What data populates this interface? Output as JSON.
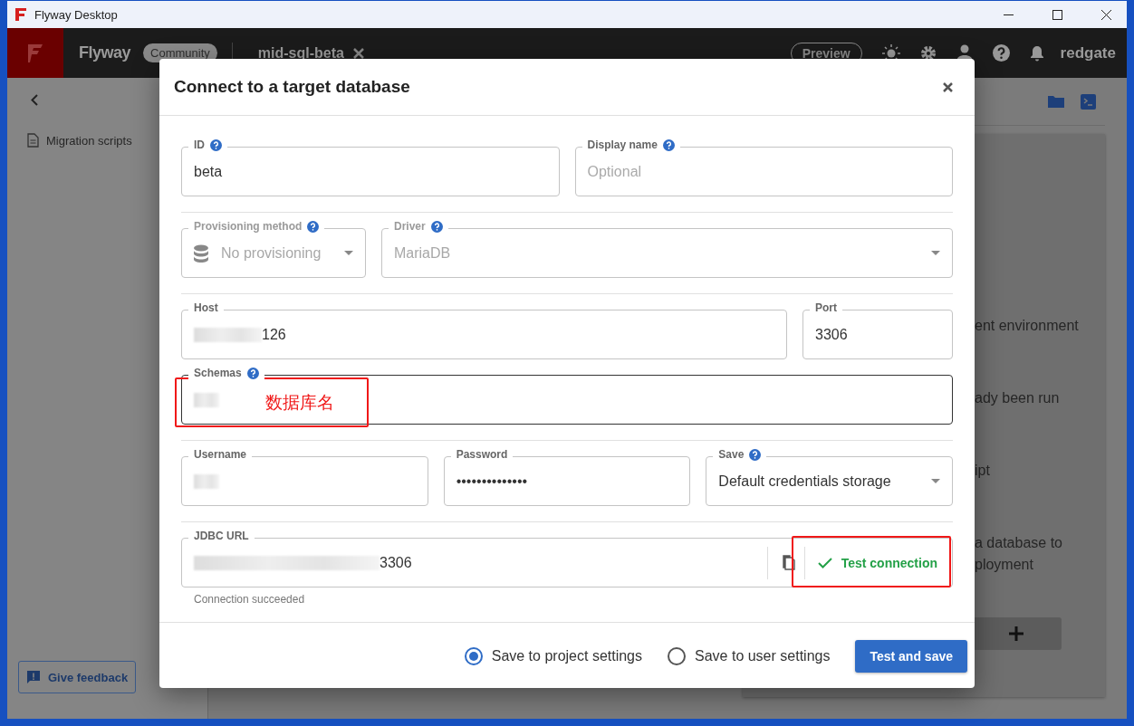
{
  "window": {
    "title": "Flyway Desktop"
  },
  "app_header": {
    "product": "Flyway",
    "edition": "Community",
    "project_tab": {
      "label": "mid-sql-beta"
    },
    "preview": "Preview",
    "brand": "redgate"
  },
  "sidebar": {
    "items": [
      {
        "label": "Migration scripts"
      }
    ],
    "feedback_button": "Give feedback"
  },
  "background_card": {
    "paragraphs": [
      {
        "lines": [
          "ent environment"
        ]
      },
      {
        "lines": [
          "ady been run"
        ]
      },
      {
        "lines": [
          "ipt"
        ]
      },
      {
        "lines": [
          "a database to",
          "ployment"
        ]
      }
    ]
  },
  "dialog": {
    "title": "Connect to a target database",
    "rows": [
      {
        "fields": [
          {
            "label": "ID",
            "help": true,
            "value": "beta"
          },
          {
            "label": "Display name",
            "help": true,
            "placeholder": "Optional"
          }
        ]
      },
      {
        "fields": [
          {
            "label": "Provisioning method",
            "help": true,
            "value": "No provisioning",
            "disabled": true,
            "dropdown": true,
            "kind": "provisioning"
          },
          {
            "label": "Driver",
            "help": true,
            "value": "MariaDB",
            "disabled": true,
            "dropdown": true
          }
        ]
      },
      {
        "fields": [
          {
            "label": "Host",
            "value": "126",
            "redacted": true
          },
          {
            "label": "Port",
            "value": "3306"
          }
        ]
      },
      {
        "fields": [
          {
            "label": "Schemas",
            "help": true,
            "redacted": true,
            "focused": true,
            "annotation": "数据库名"
          }
        ]
      },
      {
        "fields": [
          {
            "label": "Username",
            "redacted": true
          },
          {
            "label": "Password",
            "value": "••••••••••••••"
          },
          {
            "label": "Save",
            "help": true,
            "value": "Default credentials storage",
            "dropdown": true
          }
        ]
      },
      {
        "fields": [
          {
            "label": "JDBC URL",
            "value": "3306",
            "redacted": true,
            "kind": "jdbc",
            "test_button": {
              "label": "Test connection",
              "success": true,
              "highlighted": true
            },
            "helper": "Connection succeeded"
          }
        ]
      }
    ],
    "save_options": [
      {
        "label": "Save to project settings",
        "selected": true
      },
      {
        "label": "Save to user settings",
        "selected": false
      }
    ],
    "primary_button": "Test and save"
  }
}
